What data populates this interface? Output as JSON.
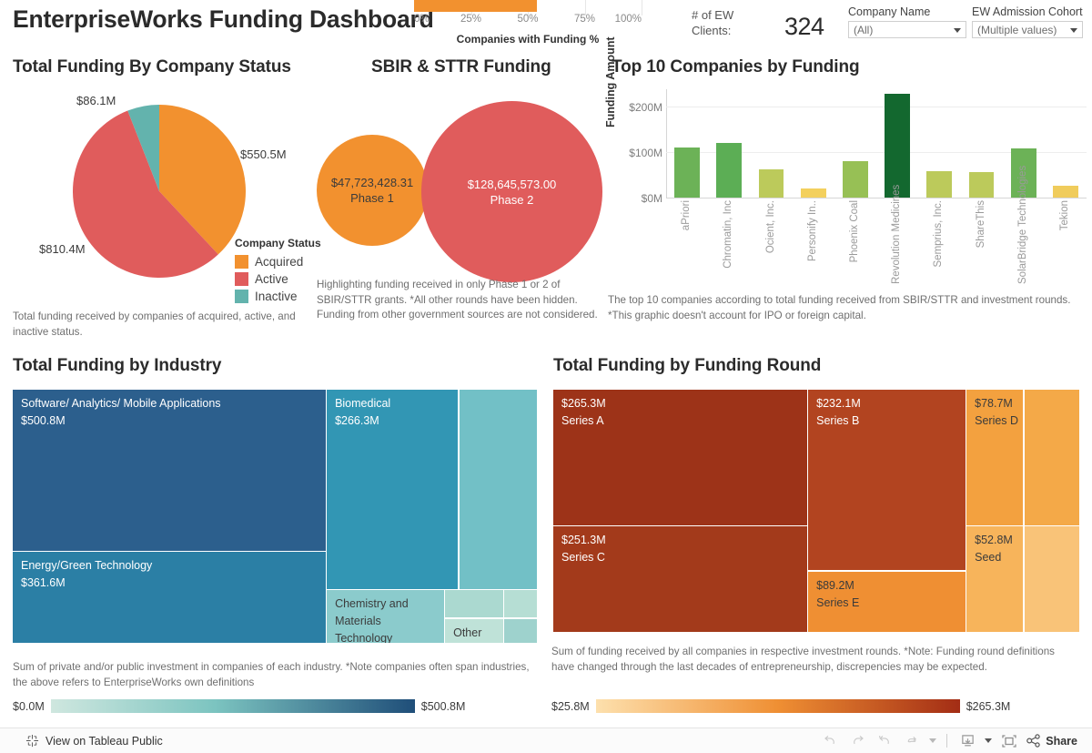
{
  "header": {
    "title": "EnterpriseWorks Funding Dashboard",
    "kpi_axis_title": "Companies with Funding %",
    "kpi_ticks": [
      "0%",
      "25%",
      "50%",
      "75%",
      "100%"
    ],
    "kpi_value_pct": 54,
    "kpi_bar_color": "#f2912f",
    "clients_label": "# of EW Clients:",
    "clients_value": "324",
    "filters": [
      {
        "label": "Company Name",
        "value": "(All)"
      },
      {
        "label": "EW Admission Cohort",
        "value": "(Multiple values)"
      }
    ]
  },
  "pie_panel": {
    "title": "Total Funding By Company Status",
    "note": "Total funding received by companies of acquired, active, and inactive status.",
    "legend_title": "Company Status",
    "chart_data": {
      "type": "pie",
      "title": "Total Funding By Company Status",
      "categories": [
        "Acquired",
        "Active",
        "Inactive"
      ],
      "labels": [
        "$550.5M",
        "$810.4M",
        "$86.1M"
      ],
      "values": [
        550.5,
        810.4,
        86.1
      ],
      "colors": [
        "#f2912f",
        "#e05c5c",
        "#63b3ad"
      ],
      "legend_position": "right"
    }
  },
  "bubble_panel": {
    "title": "SBIR & STTR Funding",
    "note": "Highlighting funding received in only Phase 1 or 2 of SBIR/STTR grants.\n*All other rounds have been hidden. Funding from other government sources are not considered.",
    "chart_data": {
      "type": "bubble",
      "title": "SBIR & STTR Funding",
      "categories": [
        "Phase 1",
        "Phase 2"
      ],
      "labels": [
        "$47,723,428.31",
        "$128,645,573.00"
      ],
      "values": [
        47723428.31,
        128645573.0
      ],
      "colors": [
        "#f2912f",
        "#e05c5c"
      ]
    }
  },
  "bar_panel": {
    "title": "Top 10 Companies by Funding",
    "note": "The top 10 companies according to total funding received from SBIR/STTR and investment rounds.\n*This graphic doesn't account for IPO or foreign capital.",
    "chart_data": {
      "type": "bar",
      "title": "Top 10 Companies by Funding",
      "ylabel": "Funding Amount",
      "xlabel": "",
      "categories": [
        "aPriori",
        "Chromatin, Inc",
        "Ocient, Inc.",
        "Personify In..",
        "Phoenix Coal",
        "Revolution Medicines",
        "Semprius, Inc.",
        "ShareThis",
        "SolarBridge Technologies",
        "Tekion"
      ],
      "values": [
        110,
        121,
        62,
        21,
        80,
        228,
        59,
        56,
        108,
        27
      ],
      "ytick_labels": [
        "$0M",
        "$100M",
        "$200M"
      ],
      "ytick_values": [
        0,
        100,
        200
      ],
      "ylim": [
        0,
        240
      ],
      "colors": [
        "#6cb257",
        "#5cae55",
        "#bcca5b",
        "#f3d05e",
        "#97c055",
        "#13682f",
        "#bcca5b",
        "#bcca5b",
        "#6cb257",
        "#f0cc5c"
      ]
    }
  },
  "industry_panel": {
    "title": "Total Funding by Industry",
    "note": "Sum of private and/or public investment in companies of each industry.\n*Note companies often span industries, the above refers to EnterpriseWorks own definitions",
    "legend": {
      "min": "$0.0M",
      "max": "$500.8M",
      "from": "#cfe7df",
      "to": "#1f4e79"
    },
    "chart_data": {
      "type": "treemap",
      "title": "Total Funding by Industry",
      "tiles": [
        {
          "name": "Software/ Analytics/ Mobile Applications",
          "value_label": "$500.8M",
          "value": 500.8,
          "color": "#2c5f8d",
          "text": "#ffffff"
        },
        {
          "name": "Energy/Green Technology",
          "value_label": "$361.6M",
          "value": 361.6,
          "color": "#2b7fa5",
          "text": "#ffffff"
        },
        {
          "name": "Biomedical",
          "value_label": "$266.3M",
          "value": 266.3,
          "color": "#3296b4",
          "text": "#ffffff"
        },
        {
          "name": "",
          "value_label": "",
          "value": 180,
          "color": "#72c0c6",
          "text": "#ffffff"
        },
        {
          "name": "Chemistry and Materials Technology",
          "value_label": "",
          "value": 95,
          "color": "#8bcbcc",
          "text": "#3b3b3b"
        },
        {
          "name": "",
          "value_label": "",
          "value": 48,
          "color": "#abd9d0",
          "text": "#3b3b3b"
        },
        {
          "name": "Other",
          "value_label": "",
          "value": 38,
          "color": "#bfe2d8",
          "text": "#3b3b3b"
        },
        {
          "name": "",
          "value_label": "",
          "value": 24,
          "color": "#b6ded4",
          "text": "#3b3b3b"
        },
        {
          "name": "",
          "value_label": "",
          "value": 20,
          "color": "#9ed2cd",
          "text": "#3b3b3b"
        }
      ]
    }
  },
  "round_panel": {
    "title": "Total Funding by Funding Round",
    "note": "Sum of funding received by all companies in respective investment rounds.\n*Note: Funding round definitions have changed through the last decades of entrepreneurship, discrepencies may be expected.",
    "legend": {
      "min": "$25.8M",
      "max": "$265.3M",
      "from": "#fde0ad",
      "to": "#a32d15"
    },
    "chart_data": {
      "type": "treemap",
      "title": "Total Funding by Funding Round",
      "tiles": [
        {
          "name": "Series A",
          "value_label": "$265.3M",
          "value": 265.3,
          "color": "#9d3318",
          "text": "#ffffff"
        },
        {
          "name": "Series C",
          "value_label": "$251.3M",
          "value": 251.3,
          "color": "#a33a1b",
          "text": "#ffffff"
        },
        {
          "name": "Series B",
          "value_label": "$232.1M",
          "value": 232.1,
          "color": "#b24420",
          "text": "#ffffff"
        },
        {
          "name": "Series E",
          "value_label": "$89.2M",
          "value": 89.2,
          "color": "#ef8f33",
          "text": "#3b3b3b"
        },
        {
          "name": "Series D",
          "value_label": "$78.7M",
          "value": 78.7,
          "color": "#f3a13f",
          "text": "#3b3b3b"
        },
        {
          "name": "",
          "value_label": "",
          "value": 68,
          "color": "#f4a948",
          "text": "#3b3b3b"
        },
        {
          "name": "Seed",
          "value_label": "$52.8M",
          "value": 52.8,
          "color": "#f7b45b",
          "text": "#3b3b3b"
        },
        {
          "name": "",
          "value_label": "",
          "value": 40,
          "color": "#f9c378",
          "text": "#3b3b3b"
        }
      ]
    }
  },
  "footer": {
    "tableau_link": "View on Tableau Public",
    "share_label": "Share",
    "tools": [
      "undo",
      "redo",
      "revert",
      "refresh",
      "pause",
      "download",
      "fullscreen"
    ]
  }
}
